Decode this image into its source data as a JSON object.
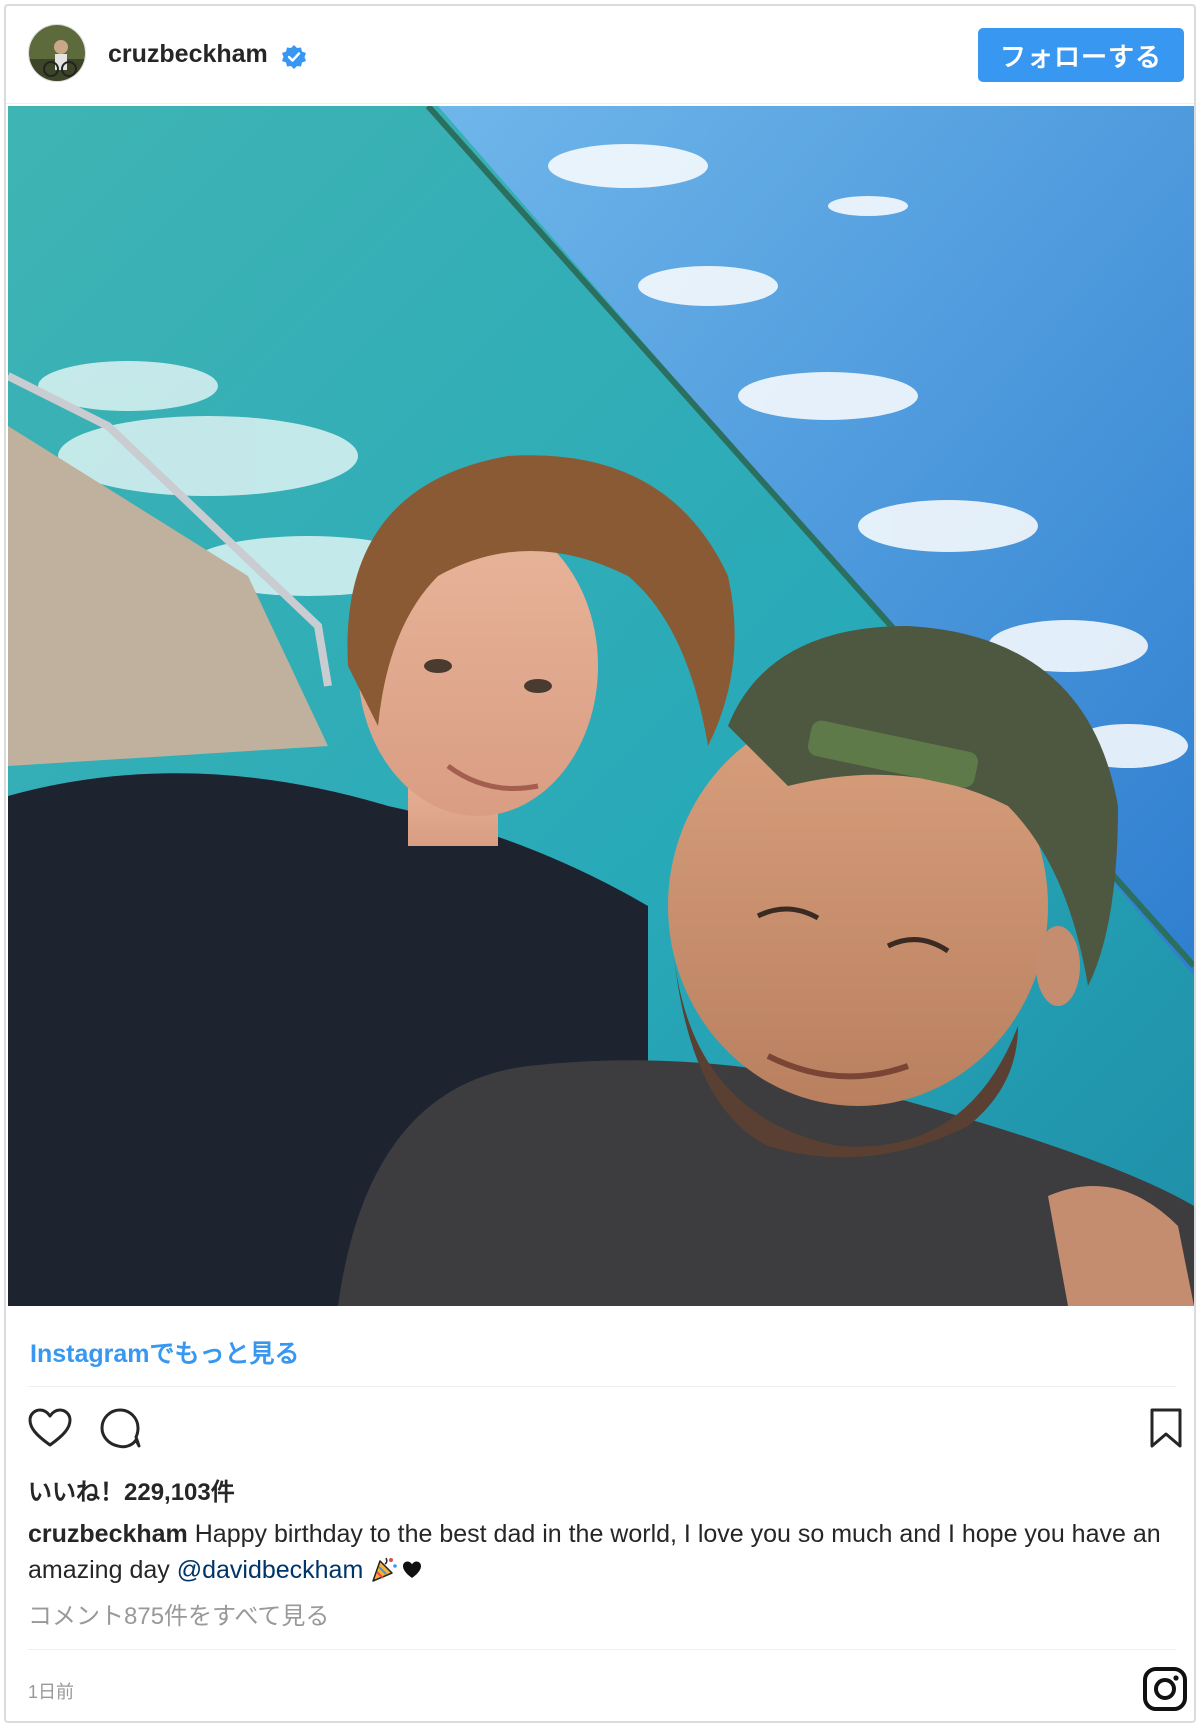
{
  "header": {
    "username": "cruzbeckham",
    "verified_icon": "verified-badge-icon",
    "follow_label": "フォローする",
    "accent_color": "#3897f0"
  },
  "photo": {
    "alt_icon": "selfie-photo"
  },
  "more_link": "Instagramでもっと見る",
  "actions": {
    "like_icon": "heart-icon",
    "comment_icon": "comment-icon",
    "save_icon": "bookmark-icon"
  },
  "likes": {
    "text": "いいね！229,103件"
  },
  "caption": {
    "user": "cruzbeckham",
    "text": "Happy birthday to the best dad in the world, I love you so much and I hope you have an amazing day",
    "mention": "@davidbeckham",
    "emojis": [
      "party-popper-icon",
      "black-heart-icon"
    ]
  },
  "view_comments": "コメント875件をすべて見る",
  "timestamp": "1日前",
  "footer": {
    "logo_icon": "instagram-logo-icon"
  }
}
